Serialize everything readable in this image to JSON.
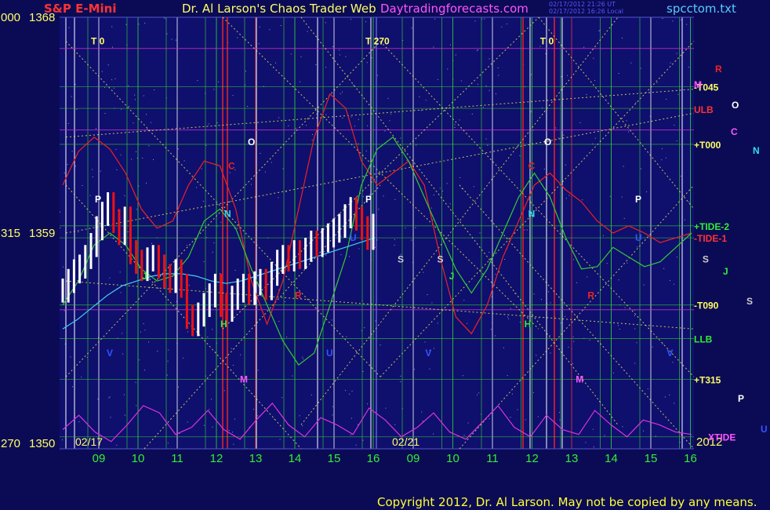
{
  "header": {
    "symbol": "S&P E-Mini",
    "title": "Dr. Al Larson's Chaos Trader Web",
    "site": "Daytradingforecasts.com",
    "file": "spcctom.txt",
    "timestamp_1": "02/17/2012 21:26 UT",
    "timestamp_2": "02/17/2012 16:26 Local"
  },
  "copyright": "Copyright 2012, Dr. Al Larson. May not be copied by any means.",
  "colors": {
    "background": "#0b0b55",
    "price_up": "#ffffff",
    "price_down": "#ee1111",
    "tide_1": "#ee2222",
    "tide_2": "#33cc33",
    "xtide": "#dd33dd",
    "ma": "#44ccee",
    "grid_dotted": "#eeee55",
    "axis_label": "#ffff66",
    "date_label": "#33ee33"
  },
  "chart_data": {
    "type": "line",
    "y_axis": {
      "ylim": [
        1350,
        1368
      ],
      "ticks": [
        {
          "label": "000",
          "price": "1368",
          "value": 1368
        },
        {
          "label": "315",
          "price": "1359",
          "value": 1359
        },
        {
          "label": "270",
          "price": "1350",
          "value": 1350
        }
      ]
    },
    "date_labels": [
      "02/17",
      "02/21",
      "2012"
    ],
    "x_hours": {
      "day1": [
        "09",
        "10",
        "11",
        "12",
        "13",
        "14",
        "15",
        "16"
      ],
      "day2": [
        "09",
        "10",
        "11",
        "12",
        "13",
        "14",
        "15",
        "16"
      ]
    },
    "right_labels": [
      {
        "text": "-T045",
        "value": 1365.1,
        "color": "#ffff66"
      },
      {
        "text": "+T000",
        "value": 1362.7,
        "color": "#ffff66"
      },
      {
        "text": "+TIDE-2",
        "value": 1359.3,
        "color": "#33ee33"
      },
      {
        "text": "-TIDE-1",
        "value": 1358.8,
        "color": "#ff3333"
      },
      {
        "text": "-T090",
        "value": 1356.0,
        "color": "#ffff66"
      },
      {
        "text": "+T315",
        "value": 1352.9,
        "color": "#ffff66"
      },
      {
        "text": "ULB",
        "value": 1364.2,
        "color": "#ff3333"
      },
      {
        "text": "LLB",
        "value": 1354.6,
        "color": "#33ee33"
      },
      {
        "text": "XTIDE",
        "value": 1350.5,
        "color": "#ff55ff"
      }
    ],
    "planet_legend": [
      {
        "text": "R",
        "color": "#ee2222"
      },
      {
        "text": "M",
        "color": "#ff55ff"
      },
      {
        "text": "O",
        "color": "#ffffff"
      },
      {
        "text": "C",
        "color": "#ff55ff"
      },
      {
        "text": "N",
        "color": "#33ddee"
      },
      {
        "text": "J",
        "color": "#33ee33"
      },
      {
        "text": "S",
        "color": "#cccccc"
      },
      {
        "text": "P",
        "color": "#ffffff"
      },
      {
        "text": "U",
        "color": "#3355ff"
      }
    ],
    "chart_markers": [
      {
        "text": "T  0",
        "color": "#ffff66",
        "hour": 0.2,
        "value": 1367.0
      },
      {
        "text": "T  270",
        "color": "#ffff66",
        "hour": 7.2,
        "value": 1367.0
      },
      {
        "text": "T  0",
        "color": "#ffff66",
        "hour": 11.6,
        "value": 1367.0
      },
      {
        "text": "P",
        "color": "#ffffff",
        "hour": 0.3,
        "value": 1360.4
      },
      {
        "text": "P",
        "color": "#ffffff",
        "hour": 7.2,
        "value": 1360.4
      },
      {
        "text": "P",
        "color": "#ffffff",
        "hour": 14.0,
        "value": 1360.4
      },
      {
        "text": "O",
        "color": "#ffffff",
        "hour": 4.2,
        "value": 1362.8
      },
      {
        "text": "O",
        "color": "#ffffff",
        "hour": 11.7,
        "value": 1362.8
      },
      {
        "text": "C",
        "color": "#ee2222",
        "hour": 3.7,
        "value": 1361.8
      },
      {
        "text": "C",
        "color": "#ee2222",
        "hour": 11.3,
        "value": 1361.8
      },
      {
        "text": "N",
        "color": "#33ddee",
        "hour": 3.6,
        "value": 1359.8
      },
      {
        "text": "N",
        "color": "#33ddee",
        "hour": 11.3,
        "value": 1359.8
      },
      {
        "text": "J",
        "color": "#33ee33",
        "hour": 1.5,
        "value": 1357.2
      },
      {
        "text": "J",
        "color": "#33ee33",
        "hour": 9.3,
        "value": 1357.2
      },
      {
        "text": "H",
        "color": "#33ee33",
        "hour": 3.5,
        "value": 1355.2
      },
      {
        "text": "H",
        "color": "#33ee33",
        "hour": 11.2,
        "value": 1355.2
      },
      {
        "text": "R",
        "color": "#ee2222",
        "hour": 5.4,
        "value": 1356.4
      },
      {
        "text": "R",
        "color": "#ee2222",
        "hour": 12.8,
        "value": 1356.4
      },
      {
        "text": "U",
        "color": "#3355ff",
        "hour": 6.8,
        "value": 1358.8
      },
      {
        "text": "U",
        "color": "#3355ff",
        "hour": 14.0,
        "value": 1358.8
      },
      {
        "text": "U",
        "color": "#3355ff",
        "hour": 6.2,
        "value": 1354.0
      },
      {
        "text": "V",
        "color": "#3355ff",
        "hour": 0.6,
        "value": 1354.0
      },
      {
        "text": "V",
        "color": "#3355ff",
        "hour": 8.7,
        "value": 1354.0
      },
      {
        "text": "V",
        "color": "#3355ff",
        "hour": 14.8,
        "value": 1354.0
      },
      {
        "text": "S",
        "color": "#cccccc",
        "hour": 8.0,
        "value": 1357.9
      },
      {
        "text": "S",
        "color": "#cccccc",
        "hour": 9.0,
        "value": 1357.9
      },
      {
        "text": "S",
        "color": "#cccccc",
        "hour": 15.7,
        "value": 1357.9
      },
      {
        "text": "M",
        "color": "#ff55ff",
        "hour": 4.0,
        "value": 1352.9
      },
      {
        "text": "M",
        "color": "#ff55ff",
        "hour": 12.5,
        "value": 1352.9
      }
    ],
    "price_series": {
      "name": "",
      "values": [
        1356.6,
        1357.0,
        1357.4,
        1357.6,
        1358.0,
        1358.5,
        1359.2,
        1359.8,
        1360.2,
        1359.5,
        1359.0,
        1359.6,
        1358.2,
        1357.8,
        1357.5,
        1357.9,
        1358.0,
        1357.6,
        1357.2,
        1357.0,
        1357.4,
        1356.8,
        1355.5,
        1355.2,
        1355.6,
        1356.0,
        1356.4,
        1356.8,
        1356.0,
        1355.8,
        1356.3,
        1356.6,
        1356.8,
        1356.5,
        1356.9,
        1357.0,
        1356.7,
        1357.3,
        1357.8,
        1358.0,
        1357.9,
        1358.2,
        1358.0,
        1358.3,
        1358.6,
        1358.5,
        1358.7,
        1358.9,
        1359.1,
        1359.3,
        1359.7,
        1360.0,
        1359.6,
        1359.2,
        1358.8,
        1359.3
      ]
    },
    "tide_1": {
      "name": "",
      "values": [
        1361.0,
        1362.4,
        1363.0,
        1362.5,
        1361.5,
        1360.0,
        1359.2,
        1359.5,
        1361.0,
        1362.0,
        1361.8,
        1360.0,
        1357.0,
        1355.2,
        1357.0,
        1360.0,
        1363.0,
        1364.8,
        1364.2,
        1362.0,
        1361.0,
        1361.5,
        1362.0,
        1361.0,
        1358.0,
        1355.5,
        1354.8,
        1356.0,
        1358.0,
        1359.5,
        1361.0,
        1361.5,
        1360.8,
        1360.3,
        1359.5,
        1359.0,
        1359.3,
        1359.0,
        1358.6,
        1358.8,
        1359.0
      ]
    },
    "tide_2": {
      "name": "",
      "values": [
        1356.0,
        1357.0,
        1358.5,
        1359.0,
        1358.5,
        1357.5,
        1357.0,
        1357.2,
        1358.0,
        1359.5,
        1360.0,
        1359.2,
        1357.5,
        1356.0,
        1354.5,
        1353.5,
        1354.0,
        1356.0,
        1358.0,
        1361.0,
        1362.5,
        1363.0,
        1362.0,
        1360.5,
        1359.0,
        1357.5,
        1356.5,
        1357.5,
        1359.0,
        1360.5,
        1361.5,
        1360.5,
        1358.8,
        1357.5,
        1357.6,
        1358.4,
        1358.0,
        1357.6,
        1357.8,
        1358.4,
        1359.0
      ]
    },
    "ma_series": {
      "name": "",
      "values": [
        1355.0,
        1355.4,
        1355.9,
        1356.4,
        1356.8,
        1357.0,
        1357.2,
        1357.3,
        1357.3,
        1357.2,
        1357.0,
        1356.9,
        1357.0,
        1357.2,
        1357.4,
        1357.6,
        1357.8,
        1358.0,
        1358.2,
        1358.4,
        1358.6,
        1358.8
      ]
    },
    "xtide": {
      "name": "",
      "values": [
        1350.8,
        1351.4,
        1350.7,
        1350.3,
        1351.0,
        1351.8,
        1351.5,
        1350.6,
        1350.9,
        1351.6,
        1350.8,
        1350.4,
        1351.2,
        1351.9,
        1351.0,
        1350.5,
        1351.3,
        1351.0,
        1350.6,
        1351.7,
        1351.2,
        1350.5,
        1350.9,
        1351.5,
        1350.7,
        1350.4,
        1351.1,
        1351.8,
        1350.9,
        1350.5,
        1351.4,
        1350.8,
        1350.6,
        1351.6,
        1351.0,
        1350.5,
        1351.2,
        1351.0,
        1350.7,
        1350.6
      ]
    }
  }
}
